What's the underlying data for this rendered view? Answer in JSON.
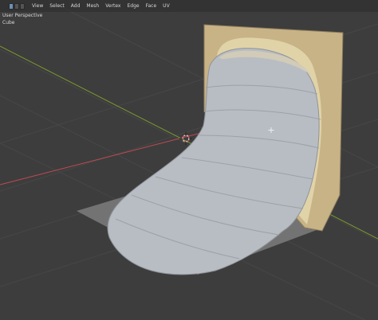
{
  "header": {
    "menu": [
      "View",
      "Select",
      "Add",
      "Mesh",
      "Vertex",
      "Edge",
      "Face",
      "UV"
    ]
  },
  "viewport": {
    "view_label": "User Perspective",
    "object_name": "Cube"
  },
  "colors": {
    "background": "#3d3d3d",
    "x_axis": "#c04a52",
    "y_axis": "#7a9a2e",
    "grid": "#484848",
    "mesh": "#b9bec4",
    "texture_plane": "#cdb78e",
    "shadow_plane": "#767676"
  }
}
